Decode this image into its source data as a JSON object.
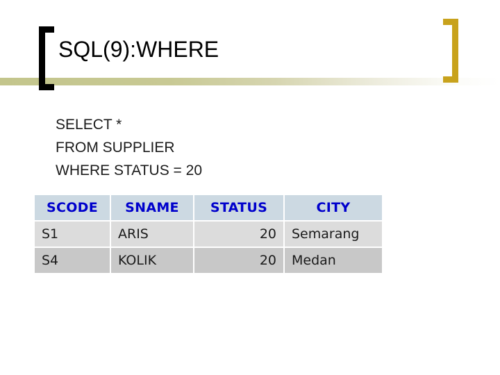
{
  "slide": {
    "title": "SQL(9):WHERE",
    "query_lines": [
      "SELECT *",
      "FROM SUPPLIER",
      "WHERE STATUS = 20"
    ],
    "decor": {
      "bracket_left_color": "#000000",
      "bracket_right_color": "#C8A21C",
      "rule_start_color": "#C3C58C",
      "rule_end_color": "#FFFFFF"
    }
  },
  "result_table": {
    "header_text_color": "#0000CC",
    "header_bg_color": "#CCD9E2",
    "row_odd_bg_color": "#DCDCDC",
    "row_even_bg_color": "#C8C8C8",
    "columns": [
      "SCODE",
      "SNAME",
      "STATUS",
      "CITY"
    ],
    "rows": [
      {
        "scode": "S1",
        "sname": "ARIS",
        "status": "20",
        "city": "Semarang"
      },
      {
        "scode": "S4",
        "sname": "KOLIK",
        "status": "20",
        "city": "Medan"
      }
    ]
  }
}
